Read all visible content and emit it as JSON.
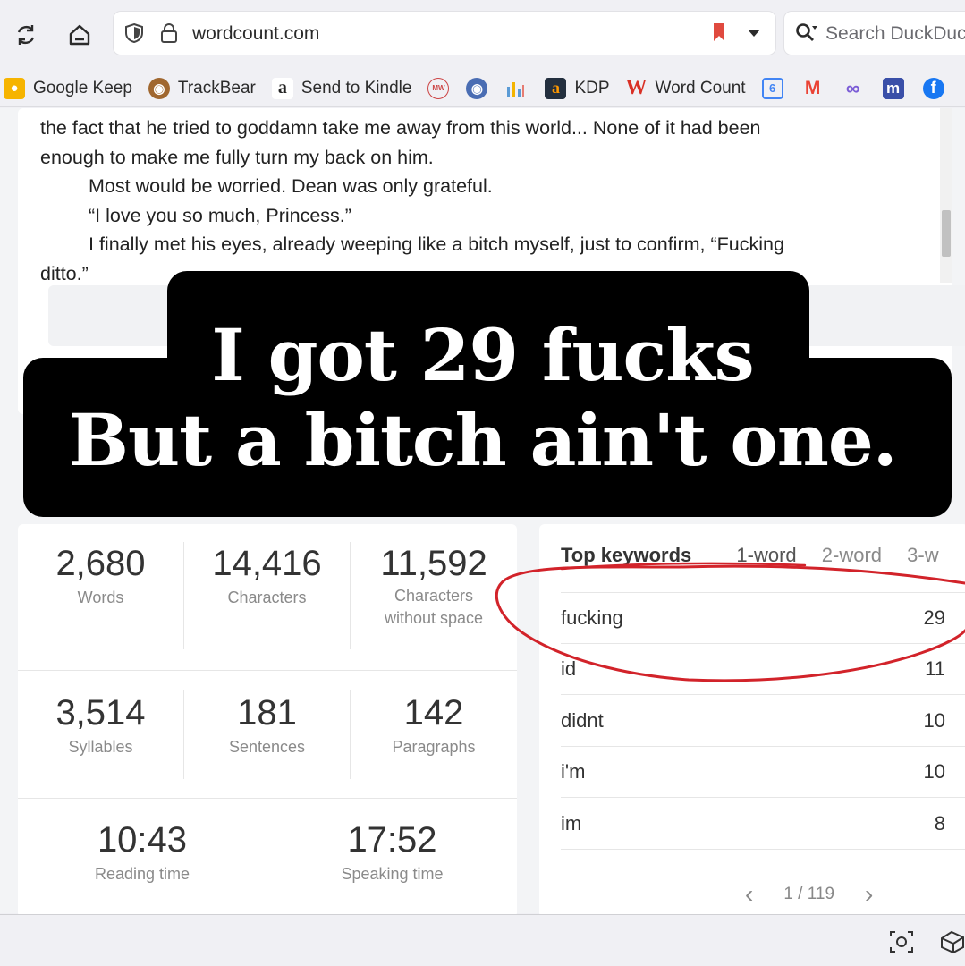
{
  "toolbar": {
    "url": "wordcount.com",
    "search_placeholder": "Search DuckDuck"
  },
  "bookmarks": [
    {
      "label": "Google Keep",
      "icon": "google-keep-icon",
      "color": "#f6b400"
    },
    {
      "label": "TrackBear",
      "icon": "bear-icon",
      "color": "#8b5a2b"
    },
    {
      "label": "Send to Kindle",
      "icon": "amazon-icon",
      "color": "#222222"
    },
    {
      "label": "KDP",
      "icon": "amazon-kdp-icon",
      "color": "#232f3e"
    },
    {
      "label": "Word Count",
      "icon": "w-icon",
      "color": "#d93025"
    }
  ],
  "editor": {
    "lines": [
      "the fact that he tried to goddamn take me away from this world... None of it had been",
      "enough to make me fully turn my back on him.",
      "Most would be worried. Dean was only grateful.",
      "“I love you so much, Princess.”",
      "I finally met his eyes, already weeping like a bitch myself, just to confirm, “Fucking",
      "ditto.”"
    ]
  },
  "stats": {
    "words": {
      "value": "2,680",
      "label": "Words"
    },
    "characters": {
      "value": "14,416",
      "label": "Characters"
    },
    "characters_no_space": {
      "value": "11,592",
      "label1": "Characters",
      "label2": "without space"
    },
    "syllables": {
      "value": "3,514",
      "label": "Syllables"
    },
    "sentences": {
      "value": "181",
      "label": "Sentences"
    },
    "paragraphs": {
      "value": "142",
      "label": "Paragraphs"
    },
    "reading_time": {
      "value": "10:43",
      "label": "Reading time"
    },
    "speaking_time": {
      "value": "17:52",
      "label": "Speaking time"
    }
  },
  "keywords": {
    "title": "Top keywords",
    "tabs": [
      "1-word",
      "2-word",
      "3-w"
    ],
    "rows": [
      {
        "word": "fucking",
        "count": "29"
      },
      {
        "word": "id",
        "count": "11"
      },
      {
        "word": "didnt",
        "count": "10"
      },
      {
        "word": "i'm",
        "count": "10"
      },
      {
        "word": "im",
        "count": "8"
      }
    ],
    "page": "1 / 119"
  },
  "caption": {
    "line1": "I got 29 fucks",
    "line2": "But a bitch ain't one."
  },
  "colors": {
    "highlight_loop": "#d2232a",
    "caption_bg": "#000000"
  }
}
